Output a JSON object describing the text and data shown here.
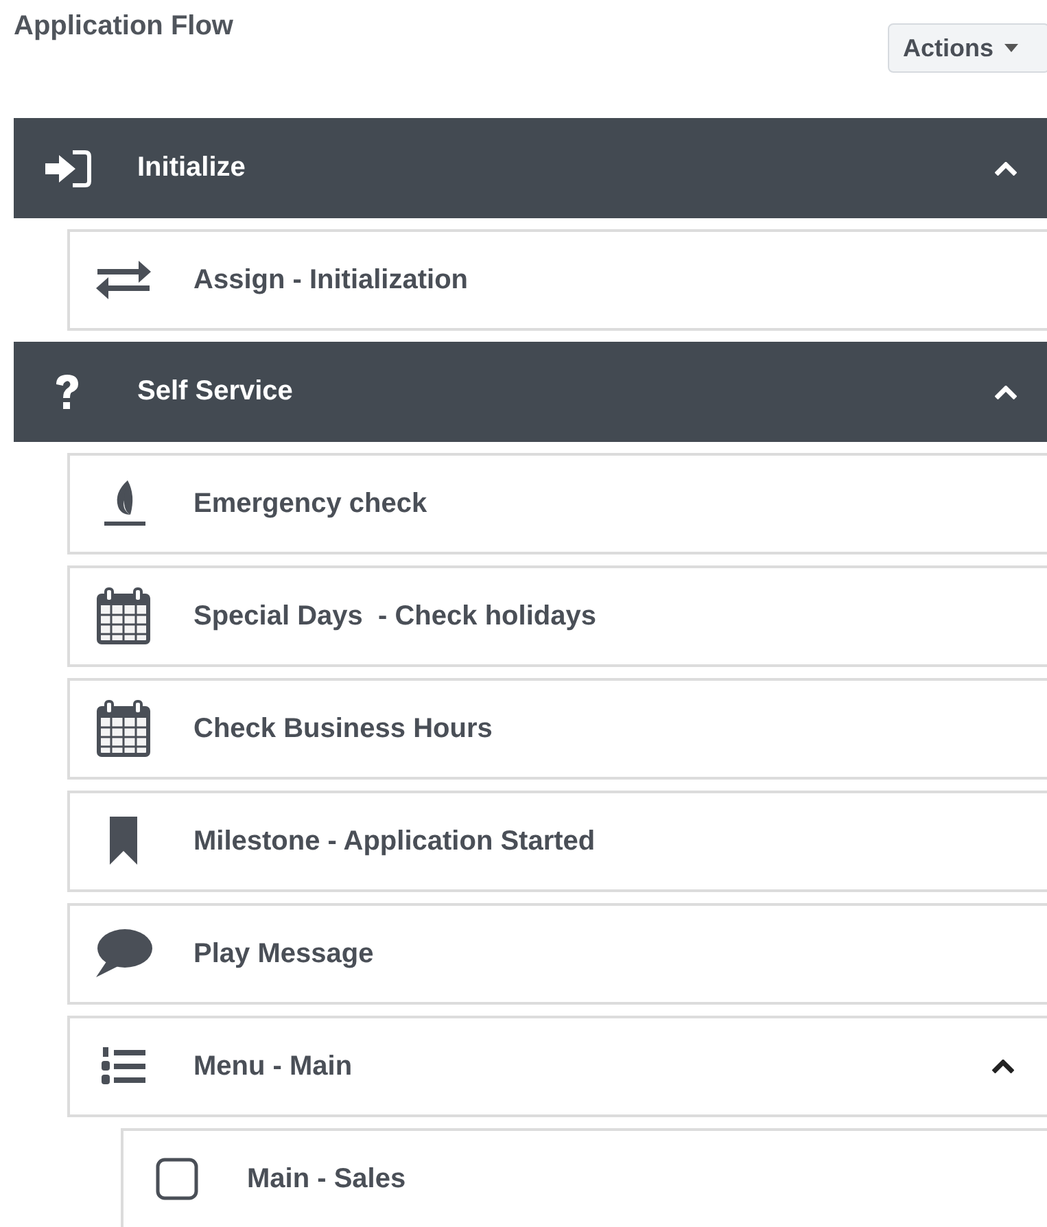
{
  "title": "Application Flow",
  "actions_button": {
    "label": "Actions"
  },
  "flow": [
    {
      "kind": "enter",
      "label": "Initialize",
      "expanded": true,
      "children": [
        {
          "kind": "exchange",
          "label": "Assign - Initialization"
        }
      ]
    },
    {
      "kind": "question",
      "label": "Self Service",
      "expanded": true,
      "children": [
        {
          "kind": "flame",
          "label": "Emergency check"
        },
        {
          "kind": "calendar",
          "label": "Special Days  - Check holidays"
        },
        {
          "kind": "calendar",
          "label": "Check Business Hours"
        },
        {
          "kind": "bookmark",
          "label": "Milestone - Application Started"
        },
        {
          "kind": "speech",
          "label": "Play Message"
        },
        {
          "kind": "numbered-list",
          "label": "Menu - Main",
          "expanded": true,
          "children": [
            {
              "kind": "square",
              "label": "Main - Sales"
            }
          ]
        }
      ]
    }
  ]
}
